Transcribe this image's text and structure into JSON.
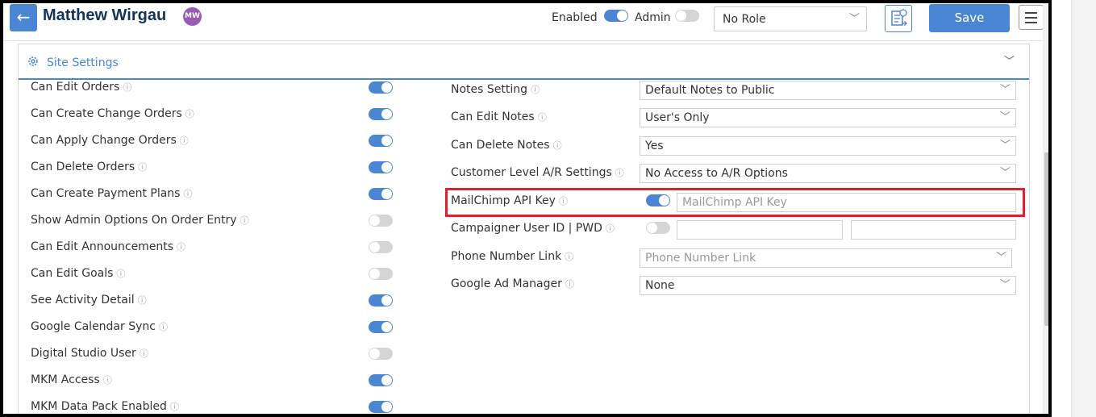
{
  "header": {
    "back_icon": "arrow-left-icon",
    "user_name": "Matthew Wirgau",
    "avatar_initials": "MW",
    "enabled_label": "Enabled",
    "enabled_on": true,
    "admin_label": "Admin",
    "admin_on": false,
    "role_value": "No Role",
    "save_label": "Save"
  },
  "panel": {
    "title": "Site Settings"
  },
  "left_settings": [
    {
      "label": "Can Edit Orders",
      "on": true
    },
    {
      "label": "Can Create Change Orders",
      "on": true
    },
    {
      "label": "Can Apply Change Orders",
      "on": true
    },
    {
      "label": "Can Delete Orders",
      "on": true
    },
    {
      "label": "Can Create Payment Plans",
      "on": true
    },
    {
      "label": "Show Admin Options On Order Entry",
      "on": false
    },
    {
      "label": "Can Edit Announcements",
      "on": false
    },
    {
      "label": "Can Edit Goals",
      "on": false
    },
    {
      "label": "See Activity Detail",
      "on": true
    },
    {
      "label": "Google Calendar Sync",
      "on": true
    },
    {
      "label": "Digital Studio User",
      "on": false
    },
    {
      "label": "MKM Access",
      "on": true
    },
    {
      "label": "MKM Data Pack Enabled",
      "on": true
    }
  ],
  "right_settings": {
    "notes_setting": {
      "label": "Notes Setting",
      "value": "Default Notes to Public"
    },
    "can_edit_notes": {
      "label": "Can Edit Notes",
      "value": "User's Only"
    },
    "can_delete_notes": {
      "label": "Can Delete Notes",
      "value": "Yes"
    },
    "customer_ar": {
      "label": "Customer Level A/R Settings",
      "value": "No Access to A/R Options"
    },
    "mailchimp": {
      "label": "MailChimp API Key",
      "on": true,
      "placeholder": "MailChimp API Key"
    },
    "campaigner": {
      "label": "Campaigner User ID | PWD",
      "on": false
    },
    "phone_link": {
      "label": "Phone Number Link",
      "placeholder": "Phone Number Link"
    },
    "google_ad": {
      "label": "Google Ad Manager",
      "value": "None"
    }
  },
  "colors": {
    "accent": "#4a86d4",
    "title": "#13325c",
    "avatar": "#9b59b6",
    "highlight": "#e0202c"
  }
}
